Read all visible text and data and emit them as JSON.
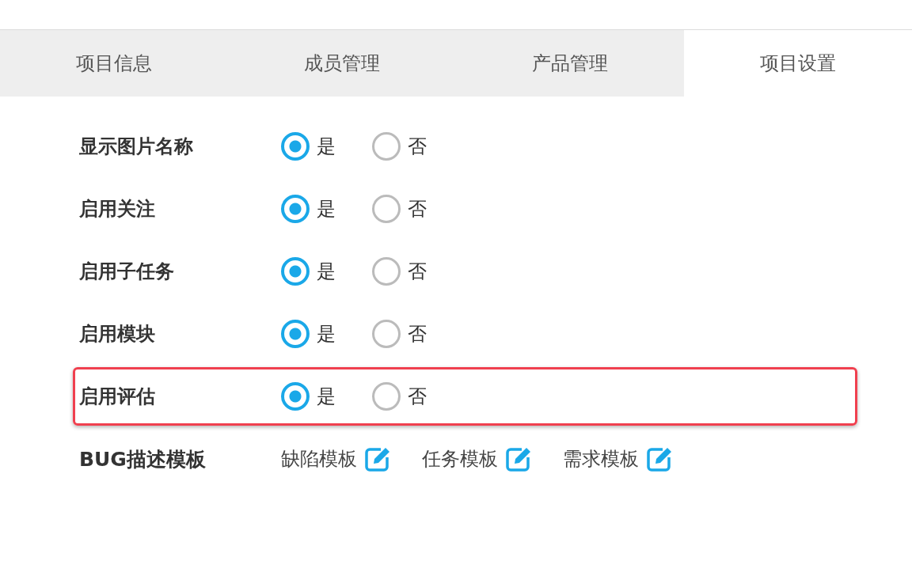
{
  "tabs": [
    {
      "label": "项目信息",
      "selected": false
    },
    {
      "label": "成员管理",
      "selected": false
    },
    {
      "label": "产品管理",
      "selected": false
    },
    {
      "label": "项目设置",
      "selected": true
    }
  ],
  "settings": [
    {
      "label": "显示图片名称",
      "highlighted": false,
      "options": [
        {
          "label": "是",
          "selected": true
        },
        {
          "label": "否",
          "selected": false
        }
      ]
    },
    {
      "label": "启用关注",
      "highlighted": false,
      "options": [
        {
          "label": "是",
          "selected": true
        },
        {
          "label": "否",
          "selected": false
        }
      ]
    },
    {
      "label": "启用子任务",
      "highlighted": false,
      "options": [
        {
          "label": "是",
          "selected": true
        },
        {
          "label": "否",
          "selected": false
        }
      ]
    },
    {
      "label": "启用模块",
      "highlighted": false,
      "options": [
        {
          "label": "是",
          "selected": true
        },
        {
          "label": "否",
          "selected": false
        }
      ]
    },
    {
      "label": "启用评估",
      "highlighted": true,
      "options": [
        {
          "label": "是",
          "selected": true
        },
        {
          "label": "否",
          "selected": false
        }
      ]
    }
  ],
  "templates": {
    "label": "BUG描述模板",
    "items": [
      {
        "label": "缺陷模板"
      },
      {
        "label": "任务模板"
      },
      {
        "label": "需求模板"
      }
    ]
  }
}
